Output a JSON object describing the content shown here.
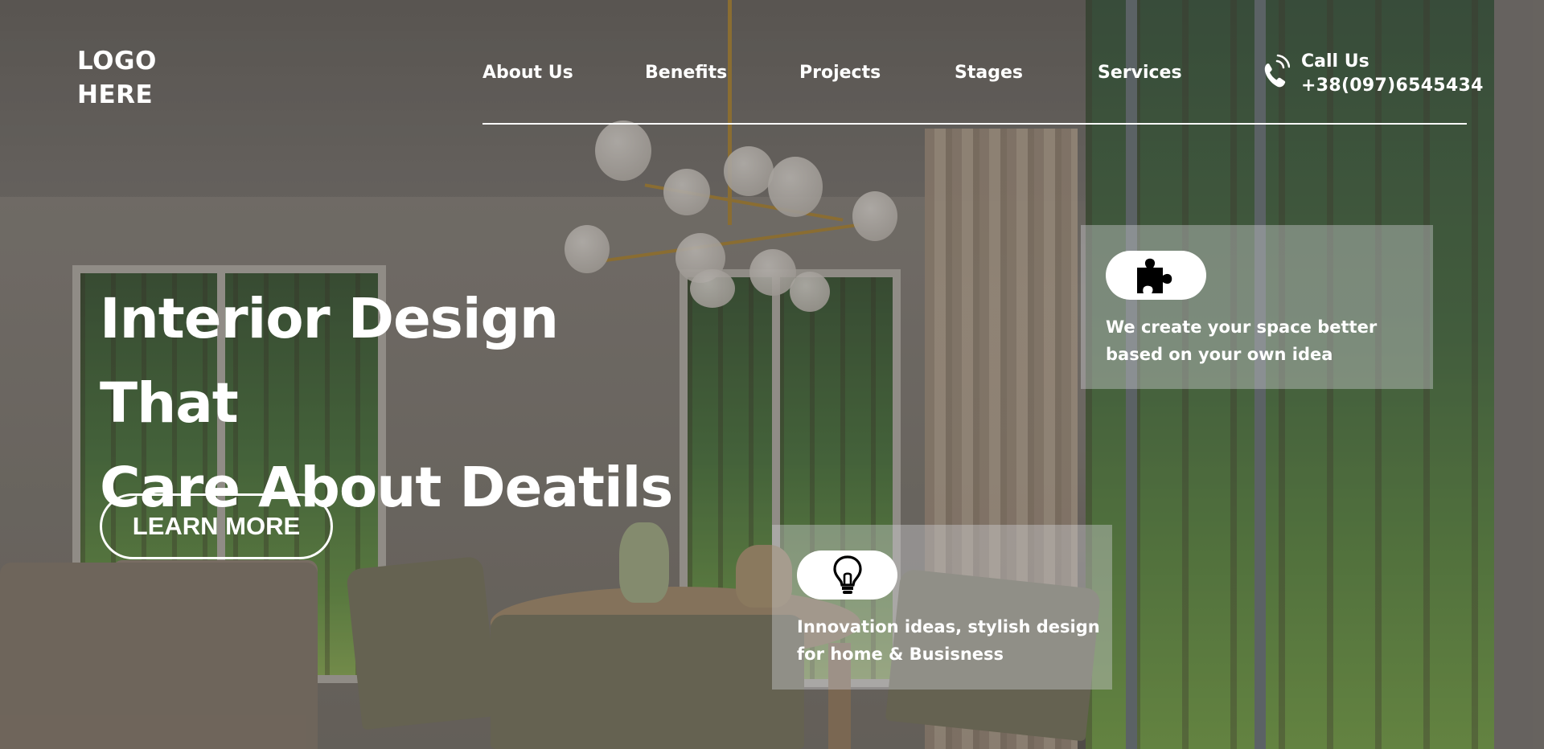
{
  "header": {
    "logo_line1": "LOGO",
    "logo_line2": "HERE",
    "nav": [
      {
        "label": "About Us"
      },
      {
        "label": "Benefits"
      },
      {
        "label": "Projects"
      },
      {
        "label": "Stages"
      },
      {
        "label": "Services"
      }
    ],
    "call": {
      "title": "Call Us",
      "number": "+38(097)6545434",
      "icon": "phone-icon"
    }
  },
  "hero": {
    "headline_line1": "Interior Design That",
    "headline_line2": "Care About Deatils",
    "cta_label": "LEARN MORE"
  },
  "cards": [
    {
      "icon": "puzzle-icon",
      "line1": "We create your space better",
      "line2": "based on your own idea"
    },
    {
      "icon": "lightbulb-icon",
      "line1": "Innovation ideas, stylish design",
      "line2": "for home & Busisness"
    }
  ],
  "colors": {
    "text": "#ffffff",
    "card_bg": "rgba(205,205,210,0.42)",
    "pill_bg": "#ffffff",
    "icon": "#000000"
  }
}
